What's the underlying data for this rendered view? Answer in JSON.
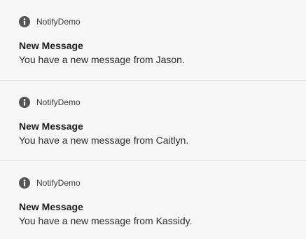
{
  "accent_color": "#555555",
  "notifications": [
    {
      "app_icon": "info-icon",
      "app_name": "NotifyDemo",
      "title": "New Message",
      "text": "You have a new message from Jason."
    },
    {
      "app_icon": "info-icon",
      "app_name": "NotifyDemo",
      "title": "New Message",
      "text": "You have a new message from Caitlyn."
    },
    {
      "app_icon": "info-icon",
      "app_name": "NotifyDemo",
      "title": "New Message",
      "text": "You have a new message from Kassidy."
    }
  ]
}
